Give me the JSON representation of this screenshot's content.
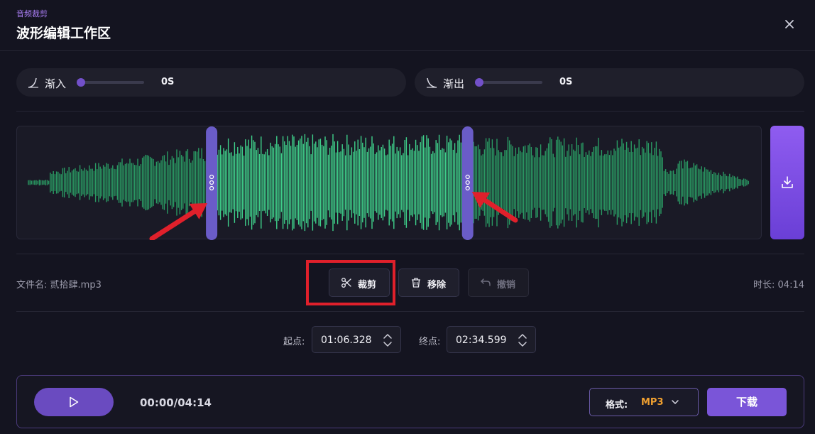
{
  "header": {
    "subtitle": "音频裁剪",
    "title": "波形编辑工作区",
    "close_icon": "close-icon"
  },
  "fade_in": {
    "label": "渐入",
    "value": "0S",
    "icon": "fade-in-curve-icon",
    "level": 0
  },
  "fade_out": {
    "label": "渐出",
    "value": "0S",
    "icon": "fade-out-curve-icon",
    "level": 0
  },
  "waveform": {
    "selection_start_fraction": 0.254,
    "selection_end_fraction": 0.609,
    "colors": {
      "selected": "#3fd08a",
      "unselected": "#2a9a63",
      "handle": "#6a5cc8",
      "arrow": "#e0202b"
    }
  },
  "file": {
    "label": "文件名:",
    "name": "贰拾肆.mp3"
  },
  "duration": {
    "label": "时长:",
    "value": "04:14"
  },
  "actions": {
    "cut": "裁剪",
    "remove": "移除",
    "undo": "撤销"
  },
  "range": {
    "start_label": "起点:",
    "start_value": "01:06.328",
    "end_label": "终点:",
    "end_value": "02:34.599"
  },
  "player": {
    "time": "00:00/04:14",
    "format_label": "格式:",
    "format_value": "MP3",
    "download_label": "下载"
  },
  "colors": {
    "accent": "#7a55d8",
    "format_value": "#f0a030",
    "highlight_box": "#e0202b"
  }
}
